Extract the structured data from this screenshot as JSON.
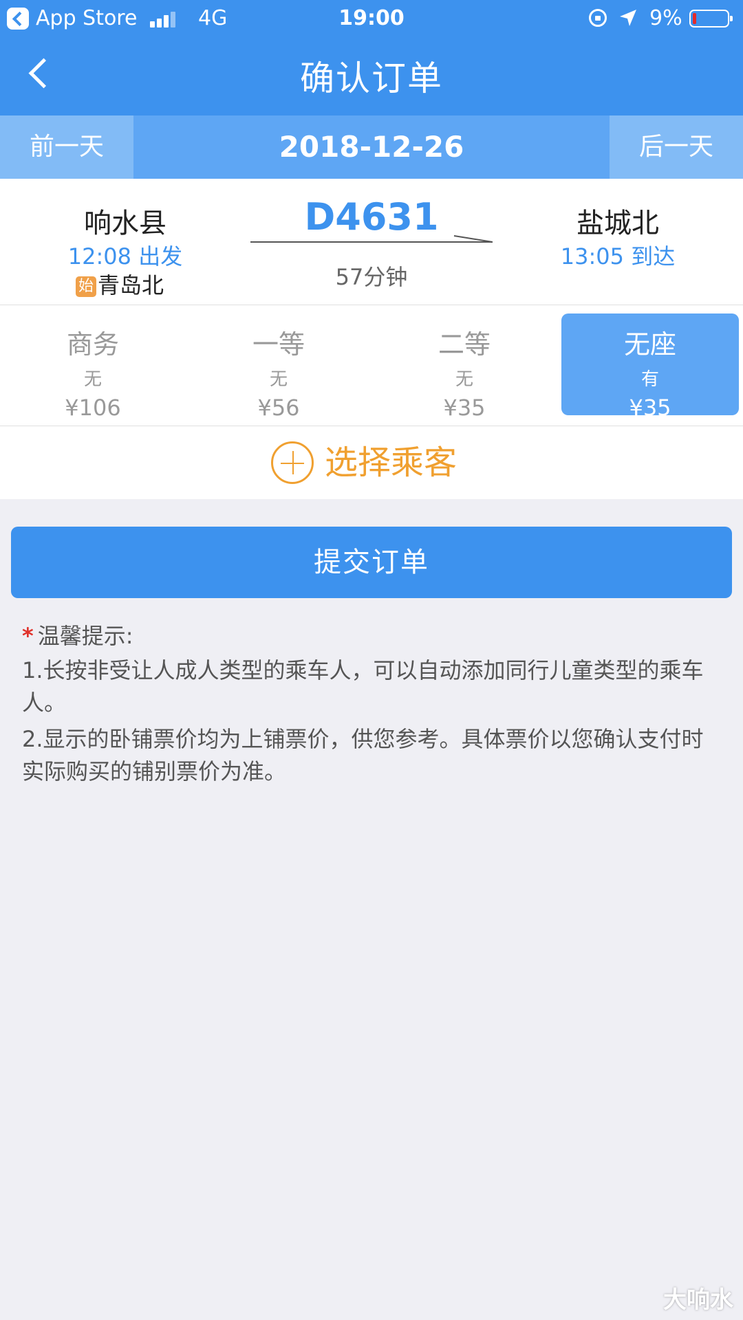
{
  "status_bar": {
    "back_app": "App Store",
    "network": "4G",
    "time": "19:00",
    "battery": "9%",
    "battery_color": "#e32b2b"
  },
  "nav": {
    "title": "确认订单",
    "back_icon": "chevron-left-icon"
  },
  "date_bar": {
    "prev_label": "前一天",
    "date": "2018-12-26",
    "next_label": "后一天"
  },
  "train": {
    "departure_station": "响水县",
    "departure_time": "12:08 出发",
    "origin_badge": "始",
    "origin_station": "青岛北",
    "number": "D4631",
    "duration": "57分钟",
    "arrival_station": "盐城北",
    "arrival_time": "13:05 到达"
  },
  "seats": [
    {
      "name": "商务",
      "availability": "无",
      "price": "¥106",
      "selected": false
    },
    {
      "name": "一等",
      "availability": "无",
      "price": "¥56",
      "selected": false
    },
    {
      "name": "二等",
      "availability": "无",
      "price": "¥35",
      "selected": false
    },
    {
      "name": "无座",
      "availability": "有",
      "price": "¥35",
      "selected": true
    }
  ],
  "passenger": {
    "label": "选择乘客",
    "icon": "plus-circle-icon"
  },
  "submit": {
    "label": "提交订单"
  },
  "tips": {
    "title": "温馨提示:",
    "lines": [
      "1.长按非受让人成人类型的乘车人，可以自动添加同行儿童类型的乘车人。",
      "2.显示的卧铺票价均为上铺票价，供您参考。具体票价以您确认支付时实际购买的铺别票价为准。"
    ]
  },
  "watermark": "大响水",
  "colors": {
    "primary": "#3d92ee",
    "accent": "#f0a030",
    "selected_seat": "#5ea6f4",
    "background": "#efeff4"
  }
}
